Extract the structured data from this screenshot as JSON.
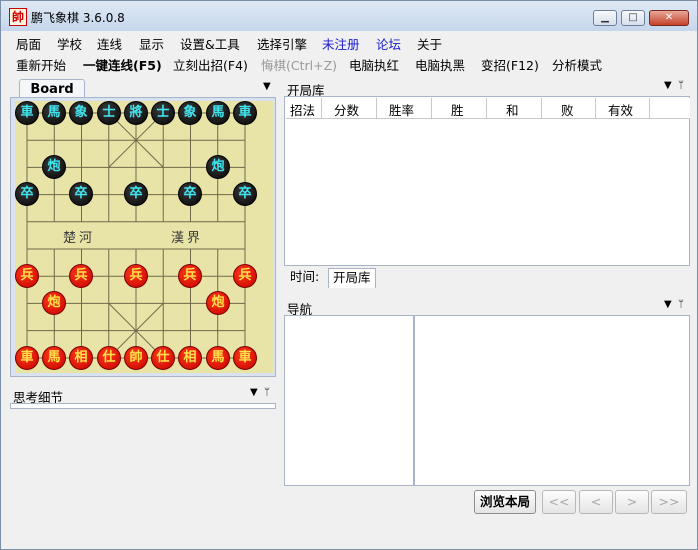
{
  "window": {
    "title": "鹏飞象棋 3.6.0.8",
    "icon_char": "帥"
  },
  "menu": [
    "局面",
    "学校",
    "连线",
    "显示",
    "设置&工具",
    "选择引擎",
    "未注册",
    "论坛",
    "关于"
  ],
  "toolbar": {
    "restart": "重新开始",
    "auto_connect": "一键连线(F5)",
    "move_now": "立刻出招(F4)",
    "undo": "悔棋(Ctrl+Z)",
    "engine_red": "电脑执红",
    "engine_black": "电脑执黑",
    "change_move": "变招(F12)",
    "analysis": "分析模式"
  },
  "board_panel": {
    "tab": "Board",
    "river_left": "楚河",
    "river_right": "漢界"
  },
  "pieces": {
    "black_back": [
      "車",
      "馬",
      "象",
      "士",
      "將",
      "士",
      "象",
      "馬",
      "車"
    ],
    "black_cannon": "炮",
    "black_pawn": "卒",
    "red_back": [
      "車",
      "馬",
      "相",
      "仕",
      "帥",
      "仕",
      "相",
      "馬",
      "車"
    ],
    "red_cannon": "炮",
    "red_pawn": "兵"
  },
  "thinking_panel": {
    "title": "思考细节"
  },
  "opening_panel": {
    "title": "开局库",
    "columns": [
      "招法",
      "分数",
      "胜率",
      "胜",
      "和",
      "败",
      "有效"
    ],
    "tab_time": "时间:",
    "tab_book": "开局库"
  },
  "nav_panel": {
    "title": "导航",
    "browse": "浏览本局",
    "first": "<<",
    "prev": "<",
    "next": ">",
    "last": ">>"
  },
  "colors": {
    "board": "#e8e4a8",
    "black_text": "#3fe6f0",
    "red_piece": "#e01010",
    "link": "#1a1ad0"
  }
}
